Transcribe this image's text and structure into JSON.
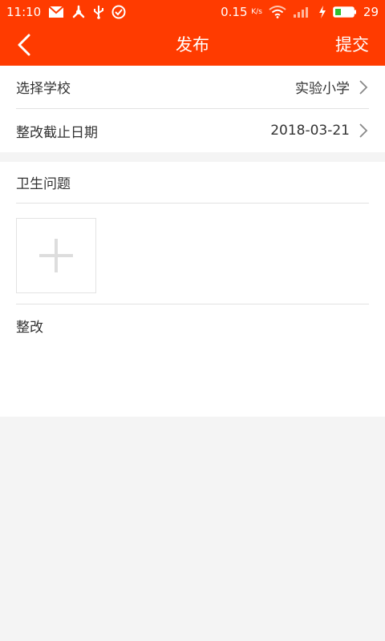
{
  "status_bar": {
    "time": "11:10",
    "speed": "0.15",
    "speed_unit": "K/s",
    "battery": "29",
    "icons": [
      "mail-icon",
      "usb-debug-icon",
      "usb-icon",
      "check-circle-icon",
      "wifi-icon",
      "signal-icon",
      "charging-icon",
      "battery-icon"
    ]
  },
  "header": {
    "title": "发布",
    "back_icon": "chevron-left-icon",
    "submit_label": "提交"
  },
  "form": {
    "school": {
      "label": "选择学校",
      "value": "实验小学"
    },
    "deadline": {
      "label": "整改截止日期",
      "value": "2018-03-21"
    },
    "problem_heading": "卫生问题",
    "add_photo_icon": "plus-icon",
    "rectify_label": "整改"
  },
  "colors": {
    "accent": "#ff3b00",
    "background": "#f4f4f4",
    "text": "#333333",
    "divider": "#e2e2e2"
  }
}
